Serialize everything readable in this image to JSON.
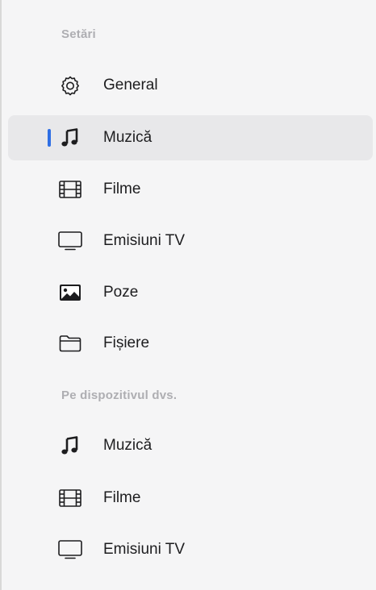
{
  "sections": [
    {
      "title": "Setări",
      "items": [
        {
          "label": "General",
          "icon": "gear-icon"
        },
        {
          "label": "Muzică",
          "icon": "music-note-icon",
          "selected": true
        },
        {
          "label": "Filme",
          "icon": "film-icon"
        },
        {
          "label": "Emisiuni TV",
          "icon": "tv-icon"
        },
        {
          "label": "Poze",
          "icon": "photo-icon"
        },
        {
          "label": "Fișiere",
          "icon": "folder-icon"
        }
      ]
    },
    {
      "title": "Pe dispozitivul dvs.",
      "items": [
        {
          "label": "Muzică",
          "icon": "music-note-icon"
        },
        {
          "label": "Filme",
          "icon": "film-icon"
        },
        {
          "label": "Emisiuni TV",
          "icon": "tv-icon"
        }
      ]
    }
  ],
  "colors": {
    "selection_indicator": "#2f6fe4",
    "selected_background": "#e8e8ea",
    "section_title": "#aeaeb2",
    "text": "#1d1d1f"
  }
}
